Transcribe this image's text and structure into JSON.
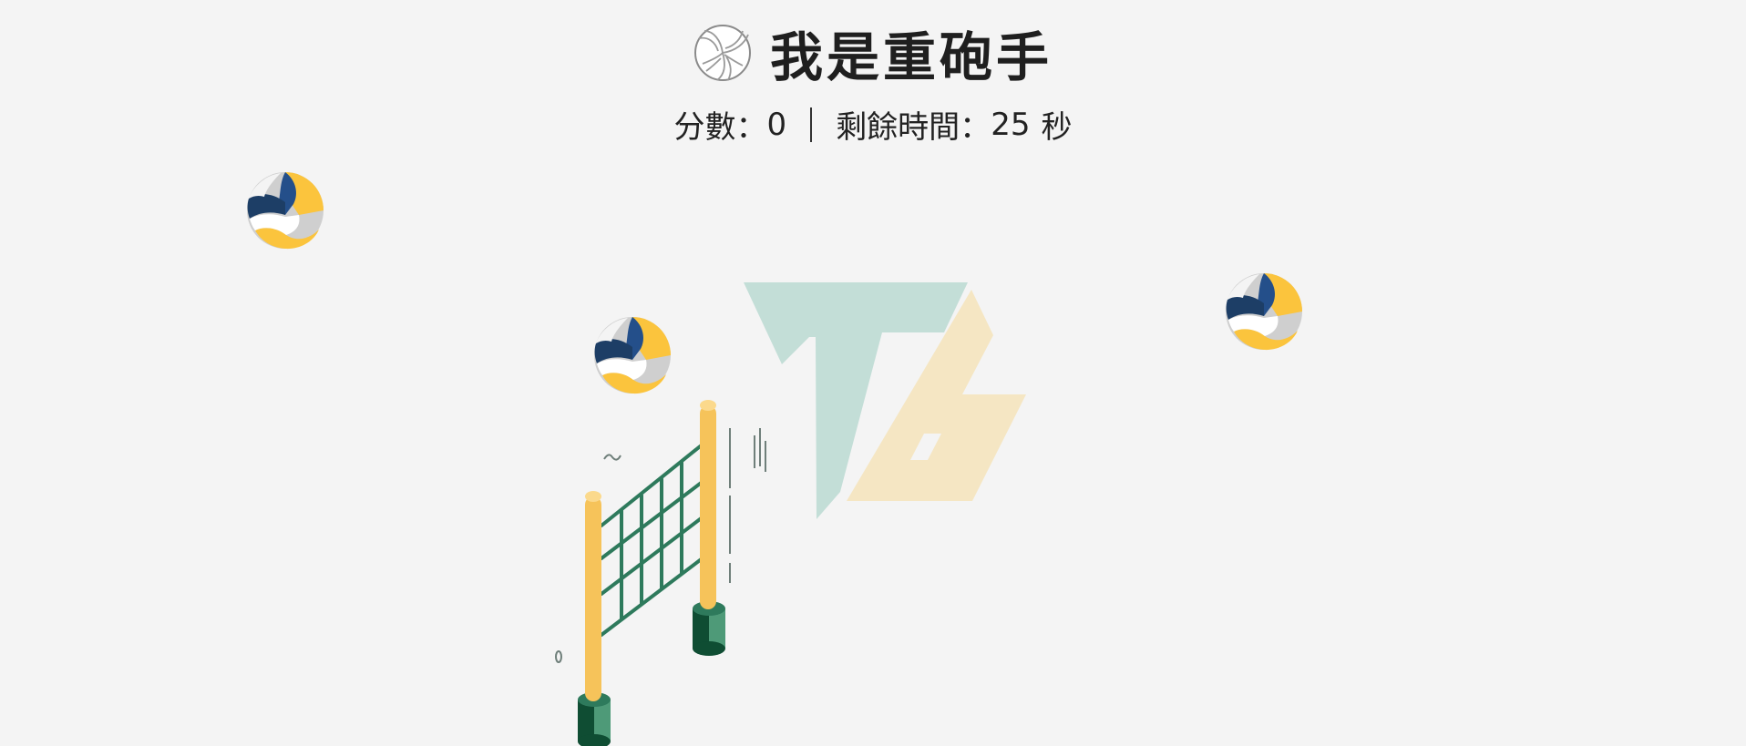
{
  "title": "我是重砲手",
  "score": {
    "label": "分數：",
    "value": "0"
  },
  "timer": {
    "label": "剩餘時間：",
    "value": "25",
    "unit": "秒"
  },
  "balls": [
    {
      "id": "ball-1"
    },
    {
      "id": "ball-2"
    },
    {
      "id": "ball-3"
    }
  ],
  "colors": {
    "background": "#f4f4f4",
    "ball_navy": "#1d3e66",
    "ball_blue": "#244f8a",
    "ball_yellow": "#fbc43d",
    "ball_grey": "#cfcfcf",
    "pole": "#f6c35a",
    "net": "#2e7a5c",
    "base_dark": "#0f4d33",
    "base_light": "#4e9a78",
    "logo_green": "#c3ded7",
    "logo_yellow": "#f5e6c3"
  },
  "icons": {
    "title_icon": "volleyball-icon",
    "ball_icon": "volleyball-icon"
  }
}
